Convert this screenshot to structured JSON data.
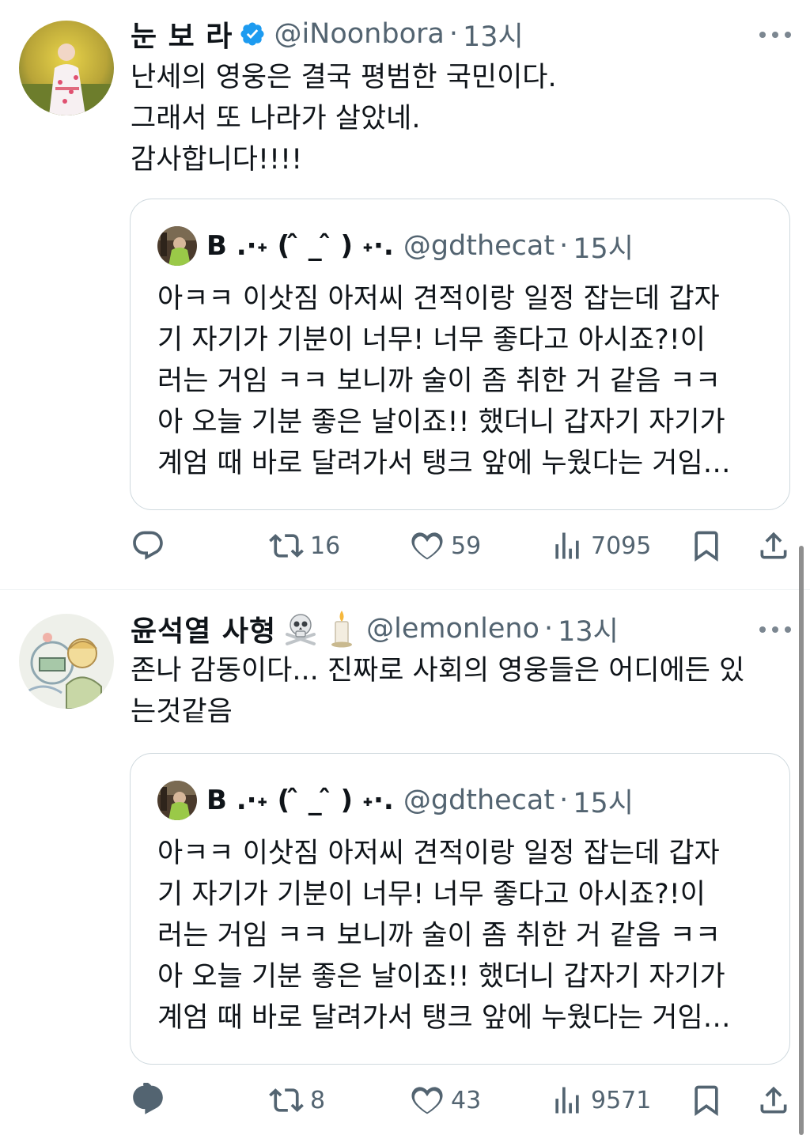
{
  "tweets": [
    {
      "name": "눈 보 라",
      "verified": true,
      "handle": "@iNoonbora",
      "time": "13시",
      "text": "난세의 영웅은 결국 평범한 국민이다.\n그래서 또 나라가 살았네.\n감사합니다!!!!",
      "quote": {
        "name": "B .⋅˖ (  ̂ _  ̂ ) ˖⋅.",
        "handle": "@gdthecat",
        "time": "15시",
        "text": "아ㅋㅋ 이삿짐 아저씨 견적이랑 일정 잡는데 갑자\n기 자기가 기분이 너무! 너무 좋다고 아시죠?!이\n러는 거임 ㅋㅋ 보니까 술이 좀 취한 거 같음 ㅋㅋ\n아 오늘 기분 좋은 날이죠!! 했더니 갑자기 자기가\n계엄 때 바로 달려가서 탱크 앞에 누웠다는 거임…"
      },
      "stats": {
        "retweets": "16",
        "likes": "59",
        "views": "7095"
      }
    },
    {
      "name": "윤석열 사형",
      "emoji": "☠️ 🕯️",
      "verified": false,
      "handle": "@lemonleno",
      "time": "13시",
      "text": "존나 감동이다... 진짜로 사회의 영웅들은 어디에든 있\n는것같음",
      "quote": {
        "name": "B .⋅˖ (  ̂ _  ̂ ) ˖⋅.",
        "handle": "@gdthecat",
        "time": "15시",
        "text": "아ㅋㅋ 이삿짐 아저씨 견적이랑 일정 잡는데 갑자\n기 자기가 기분이 너무! 너무 좋다고 아시죠?!이\n러는 거임 ㅋㅋ 보니까 술이 좀 취한 거 같음 ㅋㅋ\n아 오늘 기분 좋은 날이죠!! 했더니 갑자기 자기가\n계엄 때 바로 달려가서 탱크 앞에 누웠다는 거임…"
      },
      "stats": {
        "retweets": "8",
        "likes": "43",
        "views": "9571"
      }
    }
  ],
  "icons": {
    "reply": "reply-icon",
    "retweet": "retweet-icon",
    "like": "heart-icon",
    "views": "views-icon",
    "bookmark": "bookmark-icon",
    "share": "share-icon",
    "verified": "verified-badge-icon",
    "more": "more-icon"
  },
  "colors": {
    "verified": "#1d9bf0",
    "secondary_text": "#536471",
    "border": "#cfd9de"
  }
}
